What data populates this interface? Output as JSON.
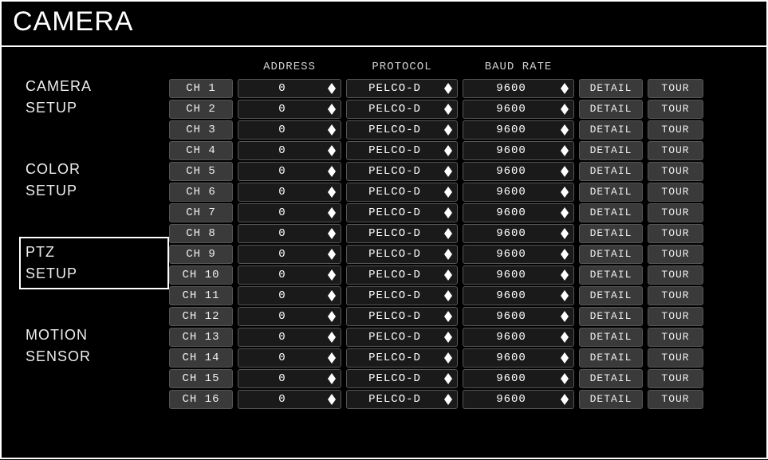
{
  "title": "CAMERA",
  "sidebar": {
    "items": [
      {
        "line1": "CAMERA",
        "line2": "SETUP",
        "active": false
      },
      {
        "line1": "COLOR",
        "line2": "SETUP",
        "active": false
      },
      {
        "line1": "PTZ",
        "line2": "SETUP",
        "active": true
      },
      {
        "line1": "MOTION",
        "line2": "SENSOR",
        "active": false
      }
    ]
  },
  "table": {
    "headers": {
      "address": "ADDRESS",
      "protocol": "PROTOCOL",
      "baud": "BAUD RATE"
    },
    "detail_label": "DETAIL",
    "tour_label": "TOUR",
    "rows": [
      {
        "ch": "CH  1",
        "address": "0",
        "protocol": "PELCO-D",
        "baud": "9600"
      },
      {
        "ch": "CH  2",
        "address": "0",
        "protocol": "PELCO-D",
        "baud": "9600"
      },
      {
        "ch": "CH  3",
        "address": "0",
        "protocol": "PELCO-D",
        "baud": "9600"
      },
      {
        "ch": "CH  4",
        "address": "0",
        "protocol": "PELCO-D",
        "baud": "9600"
      },
      {
        "ch": "CH  5",
        "address": "0",
        "protocol": "PELCO-D",
        "baud": "9600"
      },
      {
        "ch": "CH  6",
        "address": "0",
        "protocol": "PELCO-D",
        "baud": "9600"
      },
      {
        "ch": "CH  7",
        "address": "0",
        "protocol": "PELCO-D",
        "baud": "9600"
      },
      {
        "ch": "CH  8",
        "address": "0",
        "protocol": "PELCO-D",
        "baud": "9600"
      },
      {
        "ch": "CH  9",
        "address": "0",
        "protocol": "PELCO-D",
        "baud": "9600"
      },
      {
        "ch": "CH 10",
        "address": "0",
        "protocol": "PELCO-D",
        "baud": "9600"
      },
      {
        "ch": "CH 11",
        "address": "0",
        "protocol": "PELCO-D",
        "baud": "9600"
      },
      {
        "ch": "CH 12",
        "address": "0",
        "protocol": "PELCO-D",
        "baud": "9600"
      },
      {
        "ch": "CH 13",
        "address": "0",
        "protocol": "PELCO-D",
        "baud": "9600"
      },
      {
        "ch": "CH 14",
        "address": "0",
        "protocol": "PELCO-D",
        "baud": "9600"
      },
      {
        "ch": "CH 15",
        "address": "0",
        "protocol": "PELCO-D",
        "baud": "9600"
      },
      {
        "ch": "CH 16",
        "address": "0",
        "protocol": "PELCO-D",
        "baud": "9600"
      }
    ]
  }
}
